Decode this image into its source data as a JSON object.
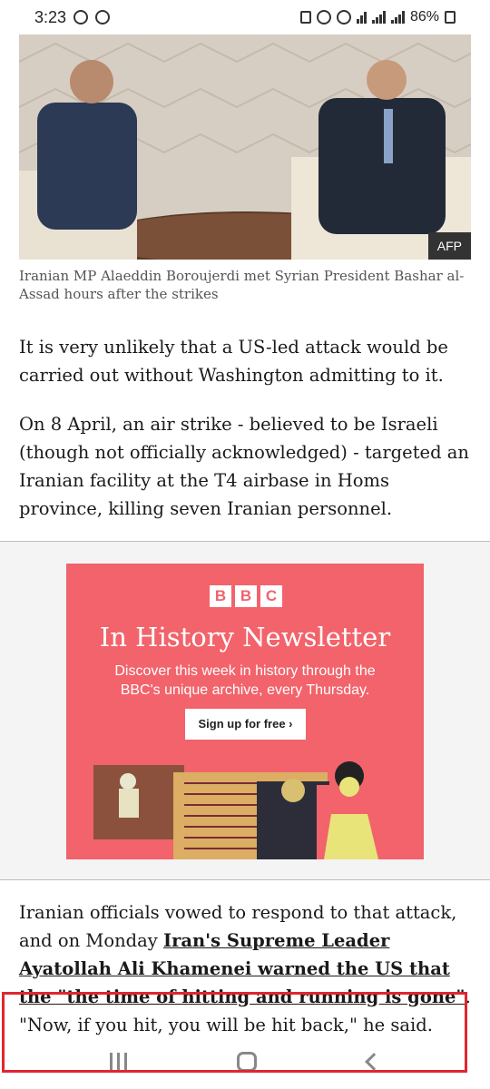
{
  "status_bar": {
    "time": "3:23",
    "battery": "86%"
  },
  "hero": {
    "credit": "AFP",
    "caption": "Iranian MP Alaeddin Boroujerdi met Syrian President Bashar al-Assad hours after the strikes"
  },
  "article": {
    "p1": "It is very unlikely that a US-led attack would be carried out without Washington admitting to it.",
    "p2": "On 8 April, an air strike - believed to be Israeli (though not officially acknowledged) - targeted an Iranian facility at the T4 airbase in Homs province, killing seven Iranian personnel.",
    "p3_start": "Iranian officials vowed to respond to that attack, and on Monday ",
    "p3_link": "Iran's Supreme Leader Ayatollah Ali Khamenei warned the US that the \"the time of hitting and running is gone\"",
    "p3_end": ". \"Now, if you hit, you will be hit back,\" he said."
  },
  "ad": {
    "brand_letters": [
      "B",
      "B",
      "C"
    ],
    "title": "In History Newsletter",
    "subtitle": "Discover this week in history through the BBC's unique archive, every Thursday.",
    "button": "Sign up for free ›"
  },
  "colors": {
    "ad_background": "#f2636b",
    "highlight_box": "#e0262f"
  }
}
